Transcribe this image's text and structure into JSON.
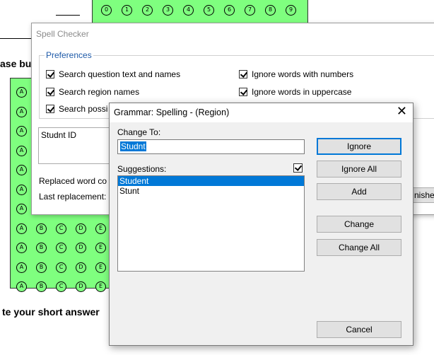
{
  "background": {
    "top_bubbles": [
      "0",
      "1",
      "2",
      "3",
      "4",
      "5",
      "6",
      "7",
      "8",
      "9"
    ],
    "left_bubble_rows": [
      [
        "A"
      ],
      [
        "A"
      ],
      [
        "A"
      ],
      [
        "A"
      ],
      [
        "A"
      ],
      [
        "A"
      ],
      [
        "A"
      ],
      [
        "A",
        "B",
        "C",
        "D",
        "E"
      ],
      [
        "A",
        "B",
        "C",
        "D",
        "E"
      ],
      [
        "A",
        "B",
        "C",
        "D",
        "E"
      ],
      [
        "A",
        "B",
        "C",
        "D",
        "E"
      ]
    ],
    "fragment_heading": "ase bu",
    "fragment_bottom": "te your short answer"
  },
  "spell_checker": {
    "title": "Spell Checker",
    "preferences_legend": "Preferences",
    "options_left": [
      "Search question text and names",
      "Search region names",
      "Search possi"
    ],
    "options_right": [
      "Ignore words with numbers",
      "Ignore words in uppercase"
    ],
    "context_text": "Studnt ID",
    "replaced_word_label": "Replaced word co",
    "last_replacement_label": "Last replacement:",
    "finish_button": "nishe"
  },
  "grammar_dialog": {
    "title": "Grammar: Spelling - (Region)",
    "change_to_label": "Change To:",
    "change_to_value": "Studnt",
    "suggestions_label": "Suggestions:",
    "suggestions": [
      "Student",
      "Stunt"
    ],
    "selected_suggestion": 0,
    "buttons": {
      "ignore": "Ignore",
      "ignore_all": "Ignore All",
      "add": "Add",
      "change": "Change",
      "change_all": "Change All",
      "cancel": "Cancel"
    }
  },
  "colors": {
    "bubble_sheet_green": "#7fff7f",
    "selection_blue": "#0078d7",
    "legend_blue": "#1e5aa8"
  }
}
